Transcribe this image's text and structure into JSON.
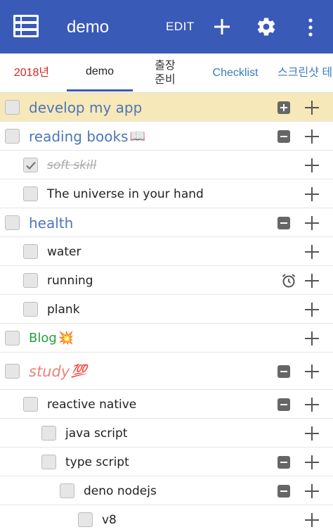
{
  "appbar": {
    "title": "demo",
    "edit_label": "EDIT",
    "icons": [
      "menu-icon",
      "plus-icon",
      "gear-icon",
      "more-vert-icon"
    ],
    "color": "#3a5ab8"
  },
  "tabs": [
    {
      "label": "2018년",
      "color": "#e02323"
    },
    {
      "label": "demo",
      "active": true
    },
    {
      "label": "출장\n준비"
    },
    {
      "label": "Checklist",
      "color": "#3a7bbf"
    },
    {
      "label": "스크린샷 테",
      "color": "#3a7bbf"
    }
  ],
  "rows": [
    {
      "text": "develop my app",
      "level": 0,
      "type": "category",
      "checked": false,
      "toggle": "expand",
      "highlight": true
    },
    {
      "text": "reading books",
      "emoji": "📖",
      "level": 0,
      "type": "category",
      "checked": false,
      "toggle": "collapse"
    },
    {
      "text": "soft skill",
      "level": 1,
      "type": "item",
      "checked": true
    },
    {
      "text": "The universe in your hand",
      "level": 1,
      "type": "item",
      "checked": false
    },
    {
      "text": "health",
      "level": 0,
      "type": "category",
      "checked": false,
      "toggle": "collapse"
    },
    {
      "text": "water",
      "level": 1,
      "type": "item",
      "checked": false
    },
    {
      "text": "running",
      "level": 1,
      "type": "item",
      "checked": false,
      "alarm": true
    },
    {
      "text": "plank",
      "level": 1,
      "type": "item",
      "checked": false
    },
    {
      "text": "Blog",
      "emoji": "💥",
      "level": 0,
      "type": "blog",
      "checked": false
    },
    {
      "text": "study",
      "emoji": "💯",
      "level": 0,
      "type": "study",
      "checked": false,
      "toggle": "collapse"
    },
    {
      "text": "reactive native",
      "level": 1,
      "type": "item",
      "checked": false,
      "toggle": "collapse"
    },
    {
      "text": "java script",
      "level": 2,
      "type": "item",
      "checked": false
    },
    {
      "text": "type script",
      "level": 2,
      "type": "item",
      "checked": false,
      "toggle": "collapse"
    },
    {
      "text": "deno nodejs",
      "level": 3,
      "type": "item",
      "checked": false,
      "toggle": "collapse"
    },
    {
      "text": "v8",
      "level": 4,
      "type": "item",
      "checked": false
    }
  ]
}
